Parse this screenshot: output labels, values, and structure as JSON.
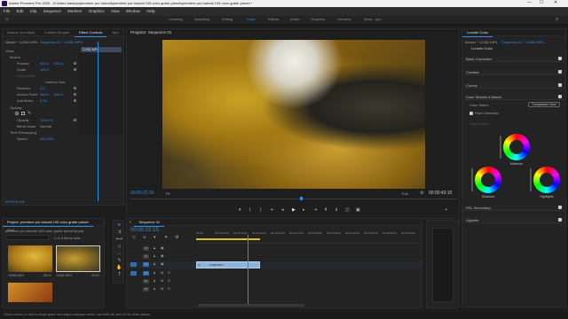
{
  "title_bar": {
    "title": "Adobe Premiere Pro 2020 - G:\\video backup\\premiere pro tutorial\\premiere pro tutorial 105 color grade preset\\premiere pro tutorial 105 color grade preset *"
  },
  "menu": [
    "File",
    "Edit",
    "Clip",
    "Sequence",
    "Markers",
    "Graphics",
    "View",
    "Window",
    "Help"
  ],
  "workspaces": [
    "Learning",
    "Assembly",
    "Editing",
    "Color",
    "Effects",
    "Audio",
    "Graphics",
    "Libraries",
    "Wma - upd"
  ],
  "workspace_active": "Color",
  "left_panel": {
    "tabs": [
      "Source: (no clips)",
      "Lumetri Scopes",
      "Effect Controls",
      "Aud"
    ],
    "active_tab": "Effect Controls",
    "master": "Master * 12482.MP4",
    "sequence": "Sequence 01 * 12482.MP4",
    "clip_label": "12482.MP4",
    "video_label": "Video",
    "motion": "Motion",
    "position_label": "Position",
    "position_x": "960.0",
    "position_y": "540.0",
    "scale_label": "Scale",
    "scale_value": "100.0",
    "scale_width_label": "Scale Width",
    "uniform_scale": "Uniform Sca",
    "rotation_label": "Rotation",
    "rotation_value": "0.0",
    "anchor_label": "Anchor Point",
    "anchor_x": "960.0",
    "anchor_y": "540.0",
    "antiflicker_label": "Anti-flicker",
    "antiflicker_value": "0.00",
    "opacity_label": "Opacity",
    "opacity_value": "100.0 %",
    "blend_label": "Blend Mode",
    "blend_value": "Normal",
    "time_remap": "Time Remapping",
    "speed_label": "Speed",
    "speed_value": "100.00%",
    "timecode": "00:00:22:15"
  },
  "program": {
    "title": "Program: Sequence 01",
    "timecode_left": "00:00:22:15",
    "fit": "Fit",
    "full": "Full",
    "timecode_right": "00:00:43:10"
  },
  "lumetri": {
    "tab": "Lumetri Color",
    "master": "Master * 12482.MP4",
    "sequence": "Sequence 01 * 12482.MP4",
    "sub": "Lumetri Color",
    "sections": [
      "Basic Correction",
      "Creative",
      "Curves",
      "Color Wheels & Match"
    ],
    "color_match": "Color Match",
    "comparison_view": "Comparison View",
    "face_detection": "Face Detection",
    "apply_match": "Apply Match",
    "midtones": "Midtones",
    "shadows": "Shadows",
    "highlights": "Highlights",
    "hsl": "HSL Secondary",
    "vignette": "Vignette"
  },
  "project": {
    "tabs": [
      "Project: premiere pro tutorial 105 color grade preset",
      "Med"
    ],
    "file": "premiere pro tutorial 105 color grade preset.prproj",
    "count": "1 of 3 items sele...",
    "items": [
      {
        "name": "15089.MP4",
        "duration": "50:12"
      },
      {
        "name": "12482.MP4",
        "duration": "49:22"
      }
    ]
  },
  "timeline": {
    "tab": "Sequence 01",
    "timecode": "00:00:22:15",
    "ruler": [
      "00:00",
      "00:00:05:00",
      "00:00:10:00",
      "00:00:15:00",
      "00:00:20:00",
      "00:00:25:00",
      "00:00:30:00",
      "00:00:35:00",
      "00:00:40:00",
      "00:00:45:00",
      "00:00:50:00",
      "00:00:55:00"
    ],
    "clip": "12482.MP4",
    "clip_fx": "fx",
    "tracks": [
      "V3",
      "V2",
      "V1",
      "A1",
      "A2",
      "A3"
    ],
    "playhead_fraction": 0.23
  },
  "status": {
    "text": "Click to select, or click in empty space and drag to marquee select. Use Shift, Alt, and Ctrl for other options."
  },
  "colors": {
    "accent": "#2d8ceb",
    "clip": "#8fb4dc",
    "bg": "#1d1d1d"
  }
}
